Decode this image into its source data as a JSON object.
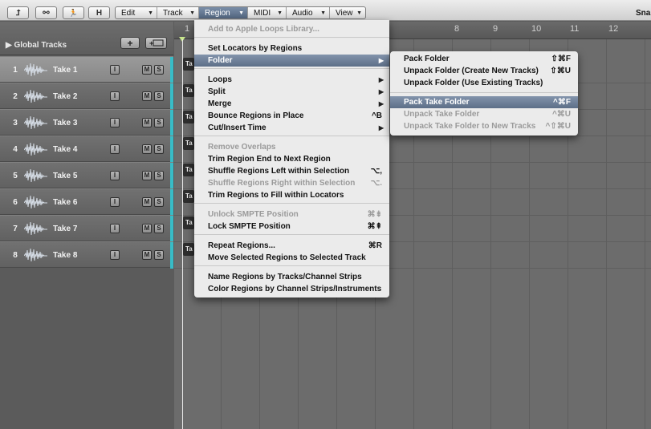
{
  "toolbar": {
    "buttons": [
      {
        "icon": "arrow-return-icon",
        "glyph": "⮥"
      },
      {
        "icon": "link-icon",
        "glyph": "⚯"
      },
      {
        "icon": "catch-runner-icon",
        "glyph": "🏃"
      },
      {
        "label": "H"
      }
    ],
    "menus": [
      {
        "label": "Edit"
      },
      {
        "label": "Track"
      },
      {
        "label": "Region"
      },
      {
        "label": "MIDI"
      },
      {
        "label": "Audio"
      },
      {
        "label": "View"
      }
    ],
    "active_menu": "Region",
    "snap_label": "Snap"
  },
  "header": {
    "global_tracks": "Global Tracks",
    "add_track_glyph": "+",
    "add_track_icon": "plus-icon",
    "folder_icon": "new-folder-icon"
  },
  "tracks": [
    {
      "num": "1",
      "name": "Take 1",
      "i": "I",
      "m": "M",
      "s": "S",
      "region": "Ta",
      "selected": true
    },
    {
      "num": "2",
      "name": "Take 2",
      "i": "I",
      "m": "M",
      "s": "S",
      "region": "Ta",
      "selected": false
    },
    {
      "num": "3",
      "name": "Take 3",
      "i": "I",
      "m": "M",
      "s": "S",
      "region": "Ta",
      "selected": false
    },
    {
      "num": "4",
      "name": "Take 4",
      "i": "I",
      "m": "M",
      "s": "S",
      "region": "Ta",
      "selected": false
    },
    {
      "num": "5",
      "name": "Take 5",
      "i": "I",
      "m": "M",
      "s": "S",
      "region": "Ta",
      "selected": false
    },
    {
      "num": "6",
      "name": "Take 6",
      "i": "I",
      "m": "M",
      "s": "S",
      "region": "Ta",
      "selected": false
    },
    {
      "num": "7",
      "name": "Take 7",
      "i": "I",
      "m": "M",
      "s": "S",
      "region": "Ta",
      "selected": false
    },
    {
      "num": "8",
      "name": "Take 8",
      "i": "I",
      "m": "M",
      "s": "S",
      "region": "Ta",
      "selected": false
    }
  ],
  "ruler": {
    "bars": [
      "1",
      "8",
      "9",
      "10",
      "11",
      "12"
    ]
  },
  "region_menu": {
    "items": [
      {
        "label": "Add to Apple Loops Library...",
        "shortcut": "",
        "submenu": false,
        "disabled": true,
        "highlight": false
      },
      {
        "label": "Set Locators by Regions",
        "shortcut": "",
        "submenu": false,
        "disabled": false,
        "highlight": false
      },
      {
        "label": "Folder",
        "shortcut": "",
        "submenu": true,
        "disabled": false,
        "highlight": true
      },
      {
        "label": "Loops",
        "shortcut": "",
        "submenu": true,
        "disabled": false,
        "highlight": false
      },
      {
        "label": "Split",
        "shortcut": "",
        "submenu": true,
        "disabled": false,
        "highlight": false
      },
      {
        "label": "Merge",
        "shortcut": "",
        "submenu": true,
        "disabled": false,
        "highlight": false
      },
      {
        "label": "Bounce Regions in Place",
        "shortcut": "^B",
        "submenu": false,
        "disabled": false,
        "highlight": false
      },
      {
        "label": "Cut/Insert Time",
        "shortcut": "",
        "submenu": true,
        "disabled": false,
        "highlight": false
      },
      {
        "label": "Remove Overlaps",
        "shortcut": "",
        "submenu": false,
        "disabled": true,
        "highlight": false
      },
      {
        "label": "Trim Region End to Next Region",
        "shortcut": "",
        "submenu": false,
        "disabled": false,
        "highlight": false
      },
      {
        "label": "Shuffle Regions Left within Selection",
        "shortcut": "⌥,",
        "submenu": false,
        "disabled": false,
        "highlight": false
      },
      {
        "label": "Shuffle Regions Right within Selection",
        "shortcut": "⌥.",
        "submenu": false,
        "disabled": true,
        "highlight": false
      },
      {
        "label": "Trim Regions to Fill within Locators",
        "shortcut": "",
        "submenu": false,
        "disabled": false,
        "highlight": false
      },
      {
        "label": "Unlock SMPTE Position",
        "shortcut": "⌘⇟",
        "submenu": false,
        "disabled": true,
        "highlight": false
      },
      {
        "label": "Lock SMPTE Position",
        "shortcut": "⌘⇞",
        "submenu": false,
        "disabled": false,
        "highlight": false
      },
      {
        "label": "Repeat Regions...",
        "shortcut": "⌘R",
        "submenu": false,
        "disabled": false,
        "highlight": false
      },
      {
        "label": "Move Selected Regions to Selected Track",
        "shortcut": "",
        "submenu": false,
        "disabled": false,
        "highlight": false
      },
      {
        "label": "Name Regions by Tracks/Channel Strips",
        "shortcut": "",
        "submenu": false,
        "disabled": false,
        "highlight": false
      },
      {
        "label": "Color Regions by Channel Strips/Instruments",
        "shortcut": "",
        "submenu": false,
        "disabled": false,
        "highlight": false
      }
    ]
  },
  "folder_submenu": {
    "items": [
      {
        "label": "Pack Folder",
        "shortcut": "⇧⌘F",
        "disabled": false,
        "highlight": false
      },
      {
        "label": "Unpack Folder (Create New Tracks)",
        "shortcut": "⇧⌘U",
        "disabled": false,
        "highlight": false
      },
      {
        "label": "Unpack Folder (Use Existing Tracks)",
        "shortcut": "",
        "disabled": false,
        "highlight": false
      },
      {
        "label": "Pack Take Folder",
        "shortcut": "^⌘F",
        "disabled": false,
        "highlight": true
      },
      {
        "label": "Unpack Take Folder",
        "shortcut": "^⌘U",
        "disabled": true,
        "highlight": false
      },
      {
        "label": "Unpack Take Folder to New Tracks",
        "shortcut": "^⇧⌘U",
        "disabled": true,
        "highlight": false
      }
    ]
  },
  "colors": {
    "track_stripe": "#38bcc7",
    "menu_highlight": "#6a7c95",
    "locator_marker": "#c8e68c"
  }
}
